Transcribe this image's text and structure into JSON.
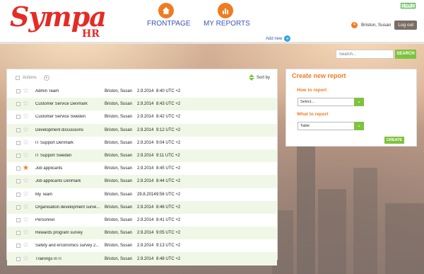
{
  "header": {
    "logo_text": "Sympa",
    "logo_sub": "HR",
    "nav": [
      {
        "label": "FRONTPAGE",
        "icon": "house-icon"
      },
      {
        "label": "MY REPORTS",
        "icon": "reports-icon"
      }
    ],
    "add_new": "Add new",
    "lang": "[ US ]",
    "notification_count": "4",
    "user_name": "Briston, Susan",
    "logout_label": "Log out"
  },
  "search": {
    "placeholder": "Search...",
    "button_label": "SEARCH"
  },
  "list": {
    "actions_label": "Actions",
    "sort_label": "Sort by",
    "rows": [
      {
        "name": "Admin Team",
        "owner": "Briston, Susan",
        "date": "2.9.2014",
        "time": "8:40 UTC +2",
        "favorite": false
      },
      {
        "name": "Customer Service Denmark",
        "owner": "Briston, Susan",
        "date": "2.9.2014",
        "time": "8:43 UTC +2",
        "favorite": false
      },
      {
        "name": "Customer Service Sweden",
        "owner": "Briston, Susan",
        "date": "2.9.2014",
        "time": "8:42 UTC +2",
        "favorite": false
      },
      {
        "name": "Development discussions",
        "owner": "Briston, Susan",
        "date": "2.9.2014",
        "time": "9:12 UTC +2",
        "favorite": false
      },
      {
        "name": "IT Support Denmark",
        "owner": "Briston, Susan",
        "date": "2.9.2014",
        "time": "9:04 UTC +2",
        "favorite": false
      },
      {
        "name": "IT Support Sweden",
        "owner": "Briston, Susan",
        "date": "2.9.2014",
        "time": "9:11 UTC +2",
        "favorite": false
      },
      {
        "name": "Job applicants",
        "owner": "Briston, Susan",
        "date": "2.9.2014",
        "time": "8:45 UTC +2",
        "favorite": true
      },
      {
        "name": "Job applicants Denmark",
        "owner": "Briston, Susan",
        "date": "2.9.2014",
        "time": "8:44 UTC +2",
        "favorite": false
      },
      {
        "name": "My Team",
        "owner": "Briston, Susan",
        "date": "29.8.2014",
        "time": "9:56 UTC +2",
        "favorite": false
      },
      {
        "name": "Organisation development surve...",
        "owner": "Briston, Susan",
        "date": "2.9.2014",
        "time": "8:46 UTC +2",
        "favorite": false
      },
      {
        "name": "Personnel",
        "owner": "Briston, Susan",
        "date": "2.9.2014",
        "time": "8:41 UTC +2",
        "favorite": false
      },
      {
        "name": "Rewards program survey",
        "owner": "Briston, Susan",
        "date": "2.9.2014",
        "time": "9:05 UTC +2",
        "favorite": false
      },
      {
        "name": "Safety and erconomics survey 2...",
        "owner": "Briston, Susan",
        "date": "2.9.2014",
        "time": "9:13 UTC +2",
        "favorite": false
      },
      {
        "name": "Trainings in IT",
        "owner": "Briston, Susan",
        "date": "2.9.2014",
        "time": "8:48 UTC +2",
        "favorite": false
      }
    ]
  },
  "create": {
    "title": "Create new report",
    "how_label": "How to report",
    "how_value": "Select...",
    "what_label": "What to report",
    "what_value": "Table",
    "button_label": "CREATE"
  },
  "colors": {
    "brand_red": "#e52b25",
    "accent_orange": "#f07b22",
    "accent_green": "#7ec33f",
    "link_blue": "#3a55b3"
  }
}
